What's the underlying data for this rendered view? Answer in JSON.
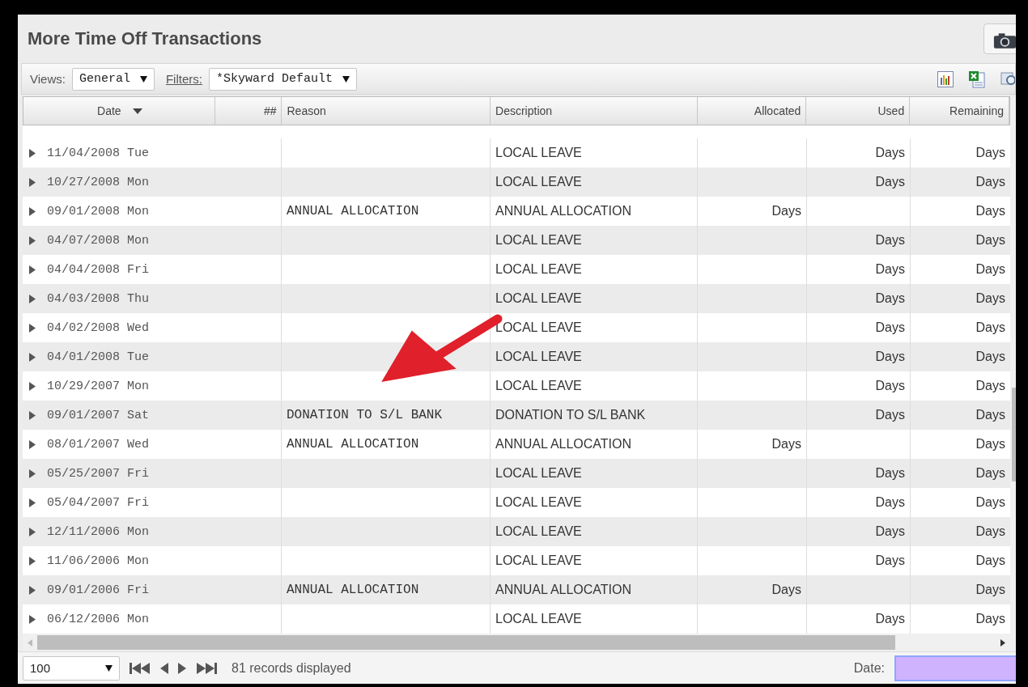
{
  "title": "More Time Off Transactions",
  "toolbar": {
    "views_label": "Views:",
    "views_value": "General",
    "filters_link": "Filters:",
    "filters_value": "*Skyward Default"
  },
  "table": {
    "columns": [
      "Date",
      "##",
      "Reason",
      "Description",
      "Allocated",
      "Used",
      "Remaining"
    ],
    "rows": [
      {
        "date": "11/04/2008 Tue",
        "reason": "",
        "description": "LOCAL LEAVE",
        "allocated": "",
        "used": "Days",
        "remaining": "Days"
      },
      {
        "date": "10/27/2008 Mon",
        "reason": "",
        "description": "LOCAL LEAVE",
        "allocated": "",
        "used": "Days",
        "remaining": "Days"
      },
      {
        "date": "09/01/2008 Mon",
        "reason": "ANNUAL ALLOCATION",
        "description": "ANNUAL ALLOCATION",
        "allocated": "Days",
        "used": "",
        "remaining": "Days"
      },
      {
        "date": "04/07/2008 Mon",
        "reason": "",
        "description": "LOCAL LEAVE",
        "allocated": "",
        "used": "Days",
        "remaining": "Days"
      },
      {
        "date": "04/04/2008 Fri",
        "reason": "",
        "description": "LOCAL LEAVE",
        "allocated": "",
        "used": "Days",
        "remaining": "Days"
      },
      {
        "date": "04/03/2008 Thu",
        "reason": "",
        "description": "LOCAL LEAVE",
        "allocated": "",
        "used": "Days",
        "remaining": "Days"
      },
      {
        "date": "04/02/2008 Wed",
        "reason": "",
        "description": "LOCAL LEAVE",
        "allocated": "",
        "used": "Days",
        "remaining": "Days"
      },
      {
        "date": "04/01/2008 Tue",
        "reason": "",
        "description": "LOCAL LEAVE",
        "allocated": "",
        "used": "Days",
        "remaining": "Days"
      },
      {
        "date": "10/29/2007 Mon",
        "reason": "",
        "description": "LOCAL LEAVE",
        "allocated": "",
        "used": "Days",
        "remaining": "Days"
      },
      {
        "date": "09/01/2007 Sat",
        "reason": "DONATION TO S/L BANK",
        "description": "DONATION TO S/L BANK",
        "allocated": "",
        "used": "Days",
        "remaining": "Days"
      },
      {
        "date": "08/01/2007 Wed",
        "reason": "ANNUAL ALLOCATION",
        "description": "ANNUAL ALLOCATION",
        "allocated": "Days",
        "used": "",
        "remaining": "Days"
      },
      {
        "date": "05/25/2007 Fri",
        "reason": "",
        "description": "LOCAL LEAVE",
        "allocated": "",
        "used": "Days",
        "remaining": "Days"
      },
      {
        "date": "05/04/2007 Fri",
        "reason": "",
        "description": "LOCAL LEAVE",
        "allocated": "",
        "used": "Days",
        "remaining": "Days"
      },
      {
        "date": "12/11/2006 Mon",
        "reason": "",
        "description": "LOCAL LEAVE",
        "allocated": "",
        "used": "Days",
        "remaining": "Days"
      },
      {
        "date": "11/06/2006 Mon",
        "reason": "",
        "description": "LOCAL LEAVE",
        "allocated": "",
        "used": "Days",
        "remaining": "Days"
      },
      {
        "date": "09/01/2006 Fri",
        "reason": "ANNUAL ALLOCATION",
        "description": "ANNUAL ALLOCATION",
        "allocated": "Days",
        "used": "",
        "remaining": "Days"
      },
      {
        "date": "06/12/2006 Mon",
        "reason": "",
        "description": "LOCAL LEAVE",
        "allocated": "",
        "used": "Days",
        "remaining": "Days"
      }
    ]
  },
  "footer": {
    "page_size": "100",
    "records": "81 records displayed",
    "date_label": "Date:"
  }
}
